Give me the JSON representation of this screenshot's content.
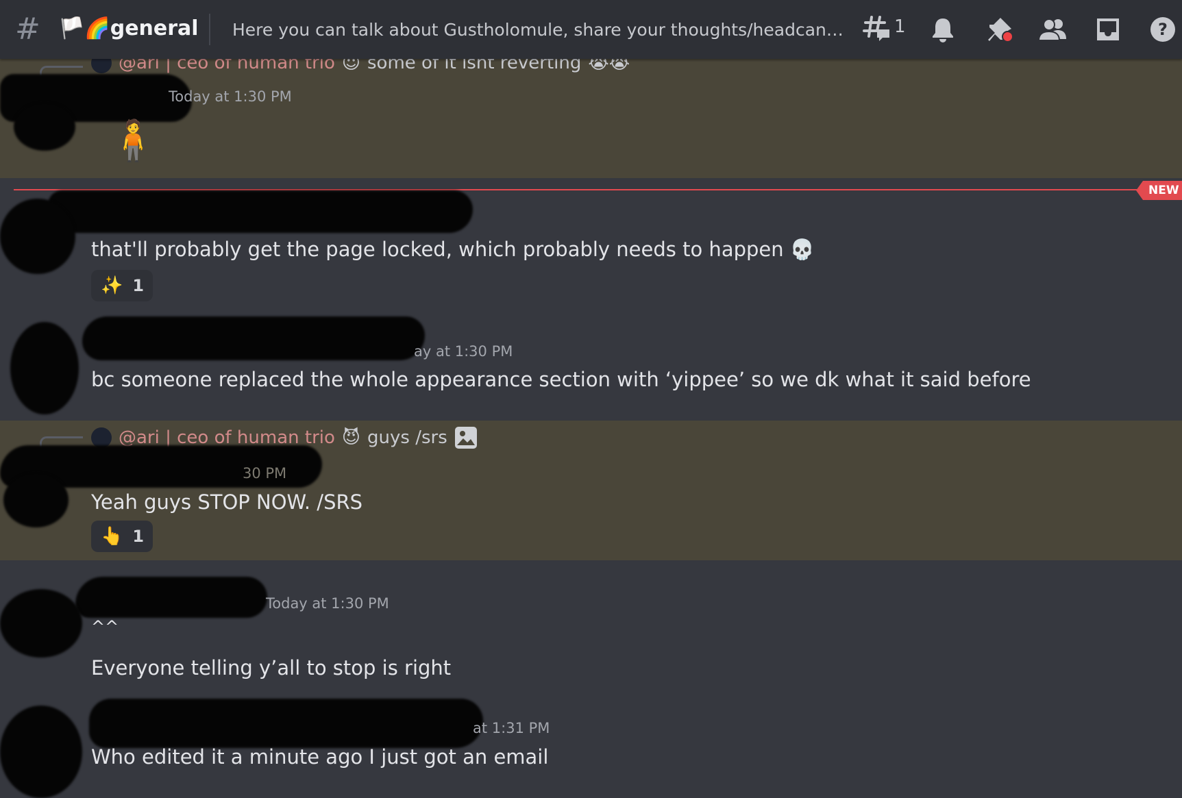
{
  "header": {
    "channel_flags": "🏳️🌈",
    "channel_name": "general",
    "topic": "Here you can talk about Gustholomule, share your thoughts/headcanons...",
    "threads_count": "1",
    "icons": [
      "hashtag-icon",
      "threads-icon",
      "bell-icon",
      "pin-icon",
      "members-icon",
      "inbox-icon",
      "help-icon"
    ]
  },
  "new_divider": {
    "label": "NEW"
  },
  "messages": [
    {
      "reply_name": "@ari | ceo of human trio",
      "reply_emoji": "😈",
      "reply_text": "some of it isnt reverting",
      "reply_trailing": "😭😭",
      "timestamp": "Today at 1:30 PM",
      "emoji": "🧍"
    },
    {
      "text": "that'll probably get the page locked, which probably needs to happen",
      "text_emoji": "💀",
      "reaction": {
        "emoji": "✨",
        "count": "1"
      }
    },
    {
      "timestamp": "ay at 1:30 PM",
      "text": "bc someone replaced the whole appearance section with ‘yippee’ so we dk what it said before"
    },
    {
      "reply_name": "@ari | ceo of human trio",
      "reply_emoji": "😈",
      "reply_text": "guys /srs",
      "timestamp": "30 PM",
      "text": "Yeah guys STOP NOW. /SRS",
      "reaction": {
        "emoji": "👆",
        "count": "1"
      }
    },
    {
      "timestamp": "Today at 1:30 PM",
      "text": "^^",
      "text2": "Everyone telling y’all to stop is right"
    },
    {
      "timestamp": "at 1:31 PM",
      "text": "Who edited it a minute ago I just got an email"
    }
  ],
  "colors": {
    "background": "#36383f",
    "header": "#2e3036",
    "highlight": "#4a4639",
    "new": "#e24a4f",
    "mention": "#d28a8a"
  }
}
